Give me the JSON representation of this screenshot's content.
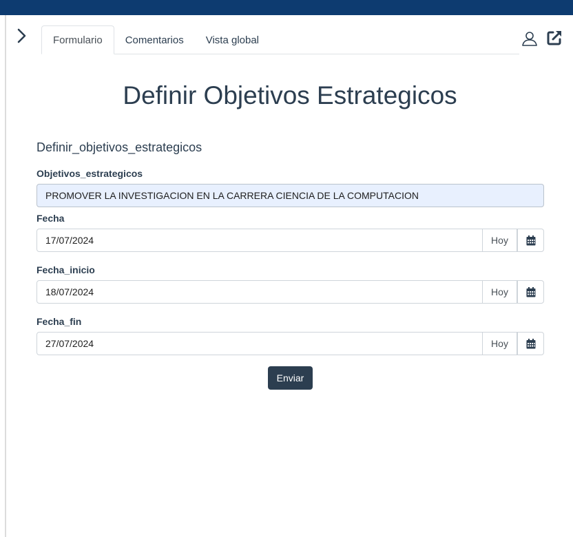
{
  "colors": {
    "topbar": "#0d3b70",
    "primary": "#2c3e50",
    "autofill_bg": "#e8f0fe"
  },
  "sidebar_toggle": {
    "icon": "chevron-right-icon"
  },
  "tabs": [
    {
      "label": "Formulario",
      "active": true
    },
    {
      "label": "Comentarios",
      "active": false
    },
    {
      "label": "Vista global",
      "active": false
    }
  ],
  "header_icons": {
    "user": "user-icon",
    "external": "external-link-icon"
  },
  "page": {
    "title": "Definir Objetivos Estrategicos"
  },
  "form": {
    "title": "Definir_objetivos_estrategicos",
    "fields": {
      "objetivos": {
        "label": "Objetivos_estrategicos",
        "value": "PROMOVER LA INVESTIGACION EN LA CARRERA CIENCIA DE LA COMPUTACION"
      },
      "fecha": {
        "label": "Fecha",
        "value": "17/07/2024",
        "today_label": "Hoy"
      },
      "fecha_inicio": {
        "label": "Fecha_inicio",
        "value": "18/07/2024",
        "today_label": "Hoy"
      },
      "fecha_fin": {
        "label": "Fecha_fin",
        "value": "27/07/2024",
        "today_label": "Hoy"
      }
    },
    "submit_label": "Enviar"
  }
}
